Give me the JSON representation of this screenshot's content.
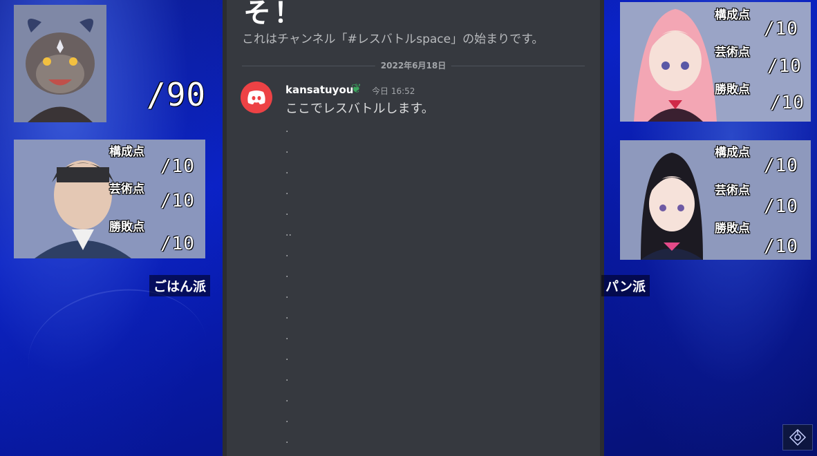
{
  "discord": {
    "channel_heading": "そ！",
    "channel_intro": "これはチャンネル「#レスバトルspace」の始まりです。",
    "date_divider": "2022年6月18日",
    "message": {
      "username": "kansatuyou",
      "timestamp": "今日 16:52",
      "text": "ここでレスバトルします。",
      "dots": [
        ".",
        ".",
        ".",
        ".",
        ".",
        "..",
        ".",
        ".",
        ".",
        ".",
        ".",
        ".",
        ".",
        ".",
        ".",
        "."
      ]
    }
  },
  "left_panel": {
    "judge_total_score": "/90",
    "criteria": [
      "構成点",
      "芸術点",
      "勝敗点"
    ],
    "scores": [
      "/10",
      "/10",
      "/10"
    ],
    "team_label": "ごはん派"
  },
  "right_panel": {
    "top_criteria": [
      "構成点",
      "芸術点",
      "勝敗点"
    ],
    "top_scores": [
      "/10",
      "/10",
      "/10"
    ],
    "bottom_criteria": [
      "構成点",
      "芸術点",
      "勝敗点"
    ],
    "bottom_scores": [
      "/10",
      "/10",
      "/10"
    ],
    "team_label": "パン派"
  },
  "colors": {
    "accent": "#ed4245",
    "discord_bg": "#36393f",
    "sprout": "#3ba55d"
  }
}
